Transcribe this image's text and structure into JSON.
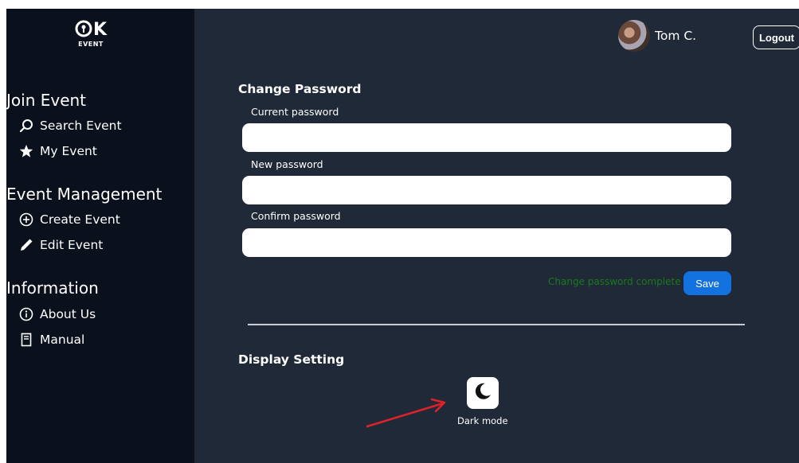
{
  "app": {
    "logo_text": "K",
    "logo_sub": "EVENT"
  },
  "sidebar": {
    "sections": [
      {
        "title": "Join Event",
        "items": [
          {
            "label": "Search Event",
            "icon": "search-icon"
          },
          {
            "label": "My Event",
            "icon": "star-icon"
          }
        ]
      },
      {
        "title": "Event Management",
        "items": [
          {
            "label": "Create Event",
            "icon": "plus-circle-icon"
          },
          {
            "label": "Edit Event",
            "icon": "pencil-icon"
          }
        ]
      },
      {
        "title": "Information",
        "items": [
          {
            "label": "About Us",
            "icon": "info-icon"
          },
          {
            "label": "Manual",
            "icon": "book-icon"
          }
        ]
      }
    ]
  },
  "header": {
    "username": "Tom C.",
    "logout_label": "Logout"
  },
  "change_password": {
    "title": "Change Password",
    "current_label": "Current password",
    "current_value": "",
    "new_label": "New password",
    "new_value": "",
    "confirm_label": "Confirm password",
    "confirm_value": "",
    "status_text": "Change password complete",
    "save_label": "Save"
  },
  "display": {
    "title": "Display Setting",
    "dark_mode_label": "Dark mode"
  },
  "colors": {
    "sidebar_bg": "#0b111c",
    "main_bg": "#1f2937",
    "accent": "#1371e0",
    "success": "#1b7a1b",
    "annotation_arrow": "#e0202a"
  }
}
